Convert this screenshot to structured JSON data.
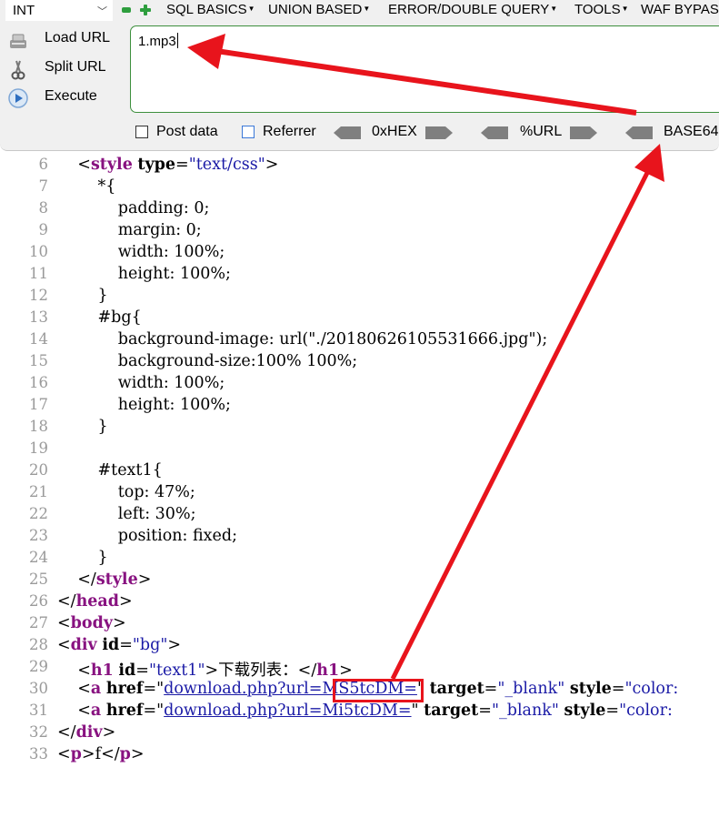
{
  "hackbar": {
    "int_select": "INT",
    "menus": [
      {
        "label": "SQL BASICS"
      },
      {
        "label": "UNION BASED"
      },
      {
        "label": "ERROR/DOUBLE QUERY"
      },
      {
        "label": "TOOLS"
      },
      {
        "label": "WAF BYPASS"
      }
    ],
    "side_buttons": {
      "load_url": "Load URL",
      "split_url": "Split URL",
      "execute": "Execute"
    },
    "url_value": "1.mp3",
    "options": {
      "post_data": "Post data",
      "referrer": "Referrer",
      "hex": "0xHEX",
      "url": "%URL",
      "base64": "BASE64"
    }
  },
  "source": {
    "lines": [
      {
        "n": "6",
        "text": ""
      },
      {
        "n": "7",
        "text": "        *{"
      },
      {
        "n": "8",
        "text": "            padding: 0;"
      },
      {
        "n": "9",
        "text": "            margin: 0;"
      },
      {
        "n": "10",
        "text": "            width: 100%;"
      },
      {
        "n": "11",
        "text": "            height: 100%;"
      },
      {
        "n": "12",
        "text": "        }"
      },
      {
        "n": "13",
        "text": "        #bg{"
      },
      {
        "n": "14",
        "text": "            background-image: url(\"./20180626105531666.jpg\");"
      },
      {
        "n": "15",
        "text": "            background-size:100% 100%;"
      },
      {
        "n": "16",
        "text": "            width: 100%;"
      },
      {
        "n": "17",
        "text": "            height: 100%;"
      },
      {
        "n": "18",
        "text": "        }"
      },
      {
        "n": "19",
        "text": ""
      },
      {
        "n": "20",
        "text": "        #text1{"
      },
      {
        "n": "21",
        "text": "            top: 47%;"
      },
      {
        "n": "22",
        "text": "            left: 30%;"
      },
      {
        "n": "23",
        "text": "            position: fixed;"
      },
      {
        "n": "24",
        "text": "        }"
      },
      {
        "n": "25",
        "text": ""
      },
      {
        "n": "26",
        "text": ""
      },
      {
        "n": "27",
        "text": ""
      },
      {
        "n": "28",
        "text": ""
      },
      {
        "n": "29",
        "text": ""
      },
      {
        "n": "30",
        "text": ""
      },
      {
        "n": "31",
        "text": ""
      },
      {
        "n": "32",
        "text": ""
      },
      {
        "n": "33",
        "text": ""
      }
    ],
    "style_open": {
      "tag": "style",
      "attr": "type",
      "val": "\"text/css\""
    },
    "style_close": "style",
    "head_close": "head",
    "body_open": "body",
    "div_open": {
      "tag": "div",
      "attr": "id",
      "val": "\"bg\""
    },
    "h1": {
      "tag": "h1",
      "attr": "id",
      "val": "\"text1\"",
      "text": "下载列表：",
      "close": "h1"
    },
    "a1": {
      "tag": "a",
      "href": "download.php?url=MS5tcDM=",
      "rest_attr": "target",
      "rest_val": "\"_blank\"",
      "style_attr": "style",
      "style_val": "\"color:"
    },
    "a2": {
      "tag": "a",
      "href": "download.php?url=Mi5tcDM=",
      "rest_attr": "target",
      "rest_val": "\"_blank\"",
      "style_attr": "style",
      "style_val": "\"color:"
    },
    "div_close": "div",
    "p": {
      "tag": "p",
      "text": "f"
    }
  },
  "colors": {
    "tag": "#881280",
    "value": "#1a1aa6",
    "annotation": "#e8141c",
    "url_border": "#3d8f3d"
  }
}
